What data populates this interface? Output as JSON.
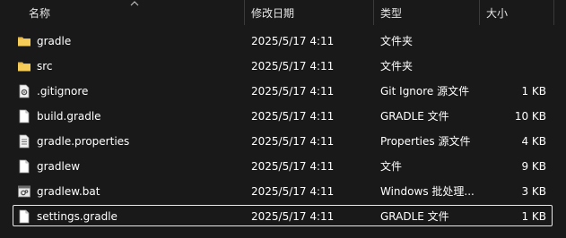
{
  "columns": {
    "name": "名称",
    "modified": "修改日期",
    "type": "类型",
    "size": "大小"
  },
  "files": [
    {
      "name": "gradle",
      "modified": "2025/5/17 4:11",
      "type": "文件夹",
      "size": "",
      "icon": "folder-icon"
    },
    {
      "name": "src",
      "modified": "2025/5/17 4:11",
      "type": "文件夹",
      "size": "",
      "icon": "folder-icon"
    },
    {
      "name": ".gitignore",
      "modified": "2025/5/17 4:11",
      "type": "Git Ignore 源文件",
      "size": "1 KB",
      "icon": "settings-file-icon"
    },
    {
      "name": "build.gradle",
      "modified": "2025/5/17 4:11",
      "type": "GRADLE 文件",
      "size": "10 KB",
      "icon": "file-icon"
    },
    {
      "name": "gradle.properties",
      "modified": "2025/5/17 4:11",
      "type": "Properties 源文件",
      "size": "4 KB",
      "icon": "text-file-icon"
    },
    {
      "name": "gradlew",
      "modified": "2025/5/17 4:11",
      "type": "文件",
      "size": "9 KB",
      "icon": "file-icon"
    },
    {
      "name": "gradlew.bat",
      "modified": "2025/5/17 4:11",
      "type": "Windows 批处理...",
      "size": "3 KB",
      "icon": "batch-file-icon"
    },
    {
      "name": "settings.gradle",
      "modified": "2025/5/17 4:11",
      "type": "GRADLE 文件",
      "size": "1 KB",
      "icon": "file-icon"
    }
  ],
  "selected_file": "settings.gradle"
}
